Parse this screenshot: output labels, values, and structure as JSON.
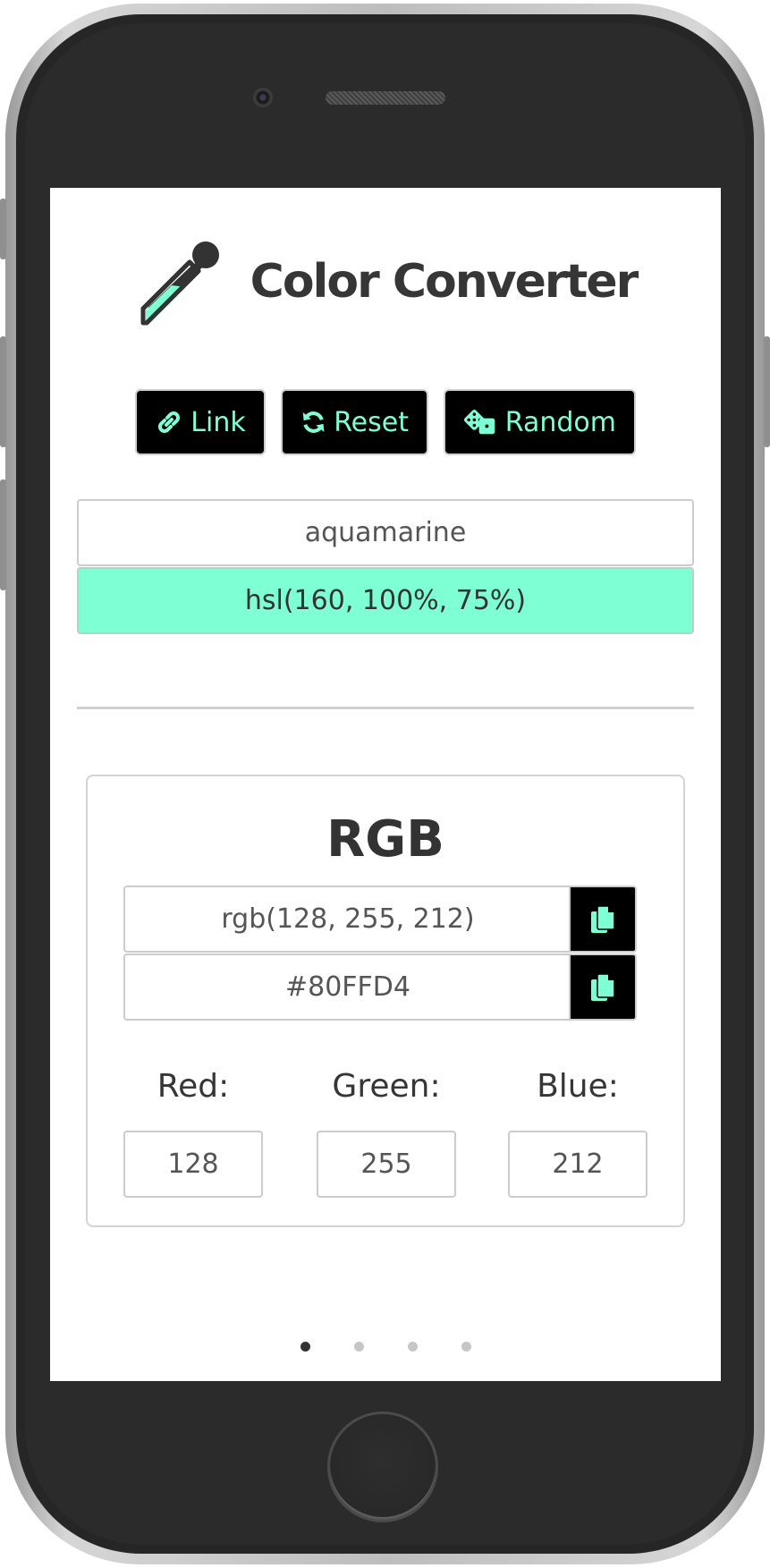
{
  "app": {
    "title": "Color Converter"
  },
  "toolbar": {
    "link_label": "Link",
    "reset_label": "Reset",
    "random_label": "Random"
  },
  "inputs": {
    "color_name": "aquamarine",
    "hsl_value": "hsl(160, 100%, 75%)"
  },
  "rgb_panel": {
    "heading": "RGB",
    "rgb_string": "rgb(128, 255, 212)",
    "hex_string": "#80FFD4",
    "channels": [
      {
        "label": "Red:",
        "value": "128"
      },
      {
        "label": "Green:",
        "value": "255"
      },
      {
        "label": "Blue:",
        "value": "212"
      }
    ]
  },
  "pagination": {
    "count": 4,
    "active": 1
  },
  "colors": {
    "accent": "#7fffd4",
    "button_bg": "#000000",
    "text": "#333333"
  },
  "icons": {
    "logo": "eyedropper-icon",
    "link": "link-icon",
    "reset": "sync-icon",
    "random": "dice-icon",
    "copy": "copy-icon"
  }
}
